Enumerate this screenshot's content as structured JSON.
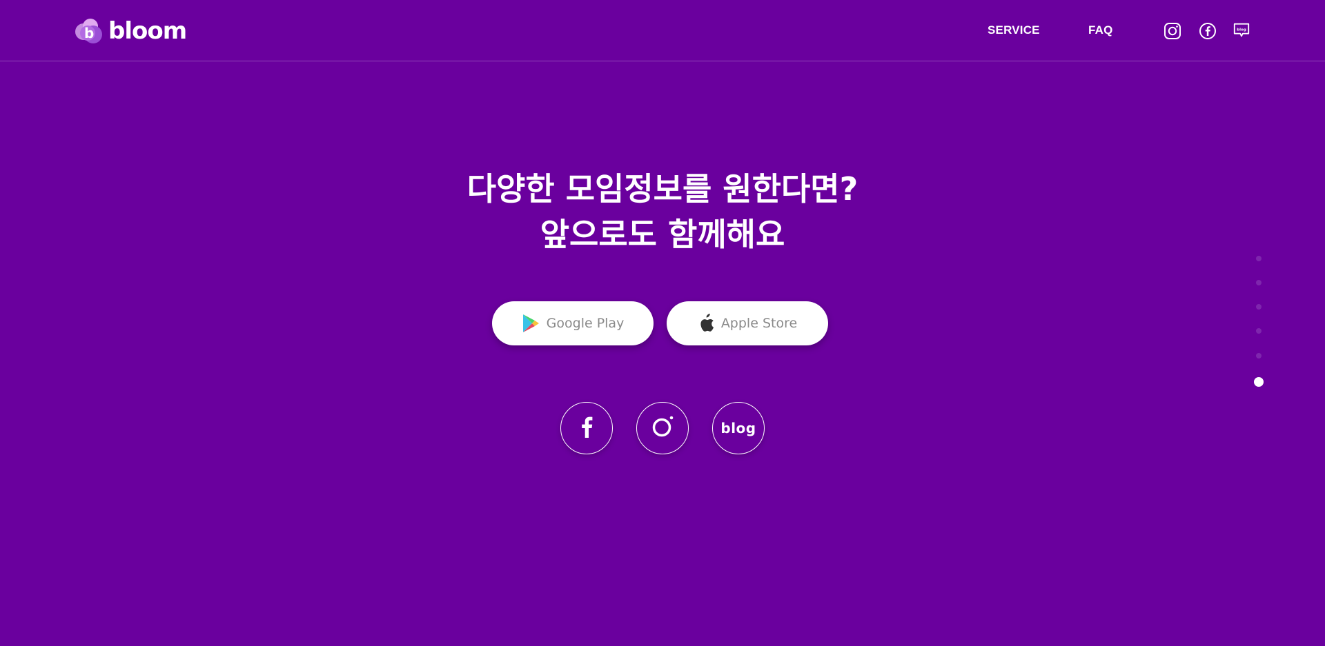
{
  "header": {
    "logo_text": "bloom",
    "nav": [
      {
        "label": "SERVICE"
      },
      {
        "label": "FAQ"
      }
    ],
    "icons": [
      "instagram-icon",
      "facebook-icon",
      "blog-chat-icon"
    ]
  },
  "hero": {
    "line1": "다양한 모임정보를 원한다면?",
    "line2": "앞으로도 함께해요",
    "buttons": {
      "google": "Google Play",
      "apple": "Apple Store"
    },
    "social": {
      "blog_label": "blog"
    }
  },
  "pagination": {
    "total": 6,
    "active_index": 5
  },
  "colors": {
    "background": "#6a009e",
    "dot_inactive": "#7e26ad",
    "button_text": "#8a8a8a"
  }
}
